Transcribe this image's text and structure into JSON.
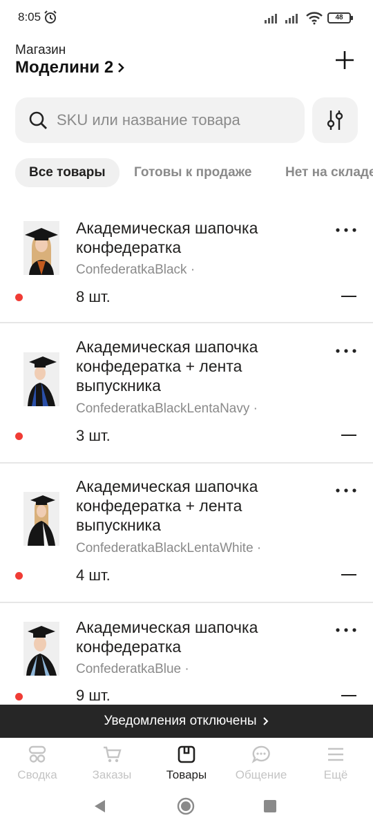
{
  "status_bar": {
    "time": "8:05",
    "battery": "48"
  },
  "header": {
    "caption": "Магазин",
    "shop_name": "Моделини 2"
  },
  "search": {
    "placeholder": "SKU или название товара"
  },
  "tabs": [
    {
      "label": "Все товары",
      "active": true
    },
    {
      "label": "Готовы к продаже",
      "active": false
    },
    {
      "label": "Нет на складе",
      "active": false
    }
  ],
  "products": [
    {
      "title": "Академическая шапочка конфедератка",
      "sku": "ConfederatkaBlack ·",
      "quantity": "8 шт."
    },
    {
      "title": "Академическая шапочка конфедератка + лента выпускника",
      "sku": "ConfederatkaBlackLentaNavy ·",
      "quantity": "3 шт."
    },
    {
      "title": "Академическая шапочка конфедератка + лента выпускника",
      "sku": "ConfederatkaBlackLentaWhite ·",
      "quantity": "4 шт."
    },
    {
      "title": "Академическая шапочка конфедератка",
      "sku": "ConfederatkaBlue ·",
      "quantity": "9 шт."
    }
  ],
  "notification": {
    "label": "Уведомления отключены"
  },
  "bottom_nav": [
    {
      "label": "Сводка",
      "icon": "dashboard-icon",
      "active": false
    },
    {
      "label": "Заказы",
      "icon": "cart-icon",
      "active": false
    },
    {
      "label": "Товары",
      "icon": "box-icon",
      "active": true
    },
    {
      "label": "Общение",
      "icon": "chat-icon",
      "active": false
    },
    {
      "label": "Ещё",
      "icon": "menu-icon",
      "active": false
    }
  ],
  "colors": {
    "accent_dot": "#f03c35",
    "notify_bg": "#262626",
    "field_bg": "#f2f2f2"
  }
}
